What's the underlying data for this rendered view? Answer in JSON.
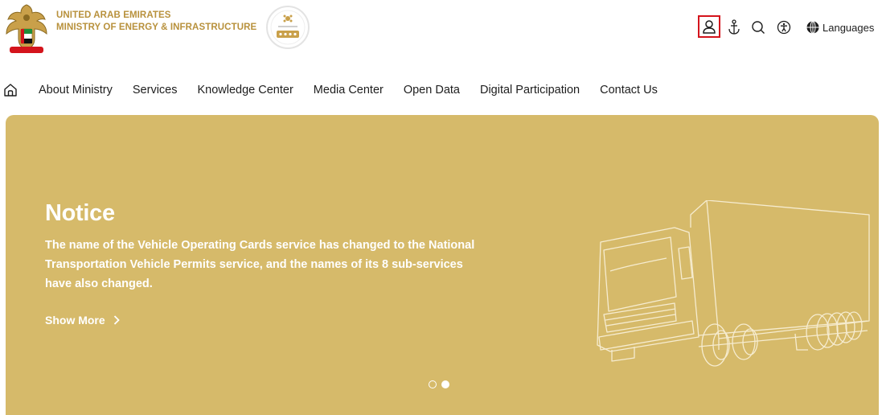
{
  "header": {
    "org_line1": "UNITED ARAB EMIRATES",
    "org_line2": "MINISTRY OF ENERGY & INFRASTRUCTURE",
    "emblem_icon": "uae-emblem-icon",
    "badge_icon": "stars-rating-badge-icon",
    "tools": {
      "user_icon": "user-icon",
      "anchor_icon": "anchor-icon",
      "search_icon": "search-icon",
      "accessibility_icon": "accessibility-icon",
      "globe_icon": "globe-icon",
      "languages_label": "Languages"
    },
    "highlight_color": "#d4141c",
    "brand_color": "#b8913c"
  },
  "nav": {
    "home_icon": "home-icon",
    "items": [
      {
        "label": "About Ministry"
      },
      {
        "label": "Services"
      },
      {
        "label": "Knowledge Center"
      },
      {
        "label": "Media Center"
      },
      {
        "label": "Open Data"
      },
      {
        "label": "Digital Participation"
      },
      {
        "label": "Contact Us"
      }
    ]
  },
  "hero": {
    "background": "#d6ba6a",
    "title": "Notice",
    "body": "The name of the Vehicle Operating Cards service has changed to the National Transportation Vehicle Permits service, and the names of its 8 sub-services have also changed.",
    "show_more": "Show More",
    "illustration_icon": "truck-icon",
    "slides": [
      {
        "active": false
      },
      {
        "active": true
      }
    ]
  }
}
